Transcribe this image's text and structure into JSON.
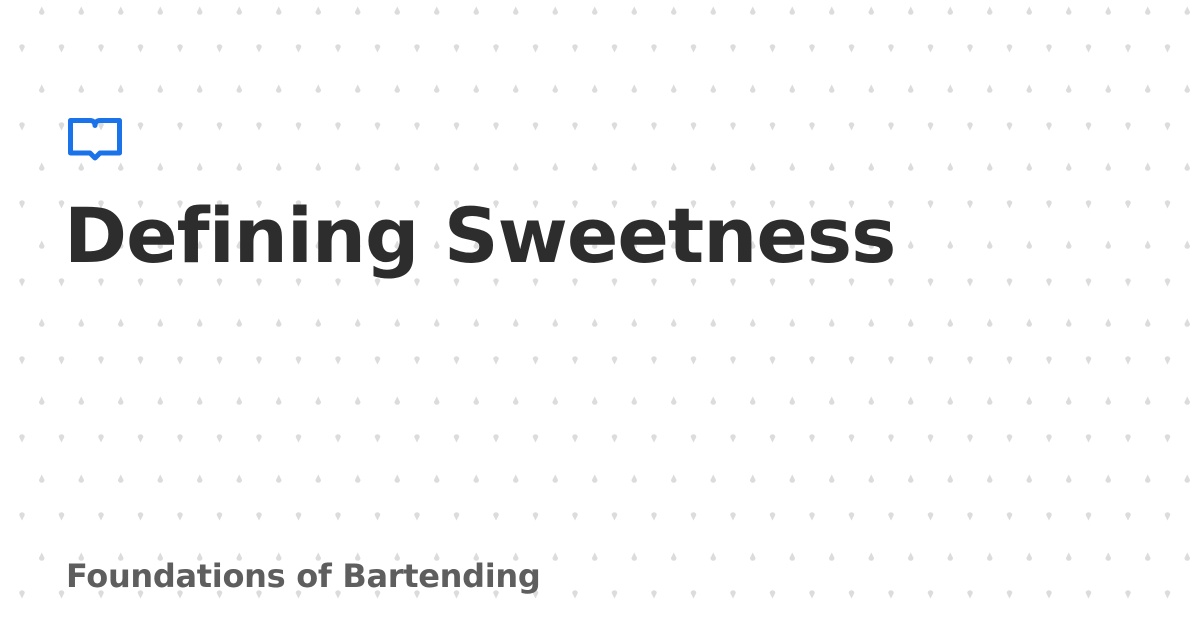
{
  "card": {
    "title": "Defining Sweetness",
    "subtitle": "Foundations of Bartending",
    "logo_icon": "open-book-icon"
  },
  "colors": {
    "background": "#ffffff",
    "pattern_dot": "#dcdcdc",
    "accent": "#1a73e8",
    "title": "#2d2d2d",
    "subtitle": "#5e5e5e"
  }
}
